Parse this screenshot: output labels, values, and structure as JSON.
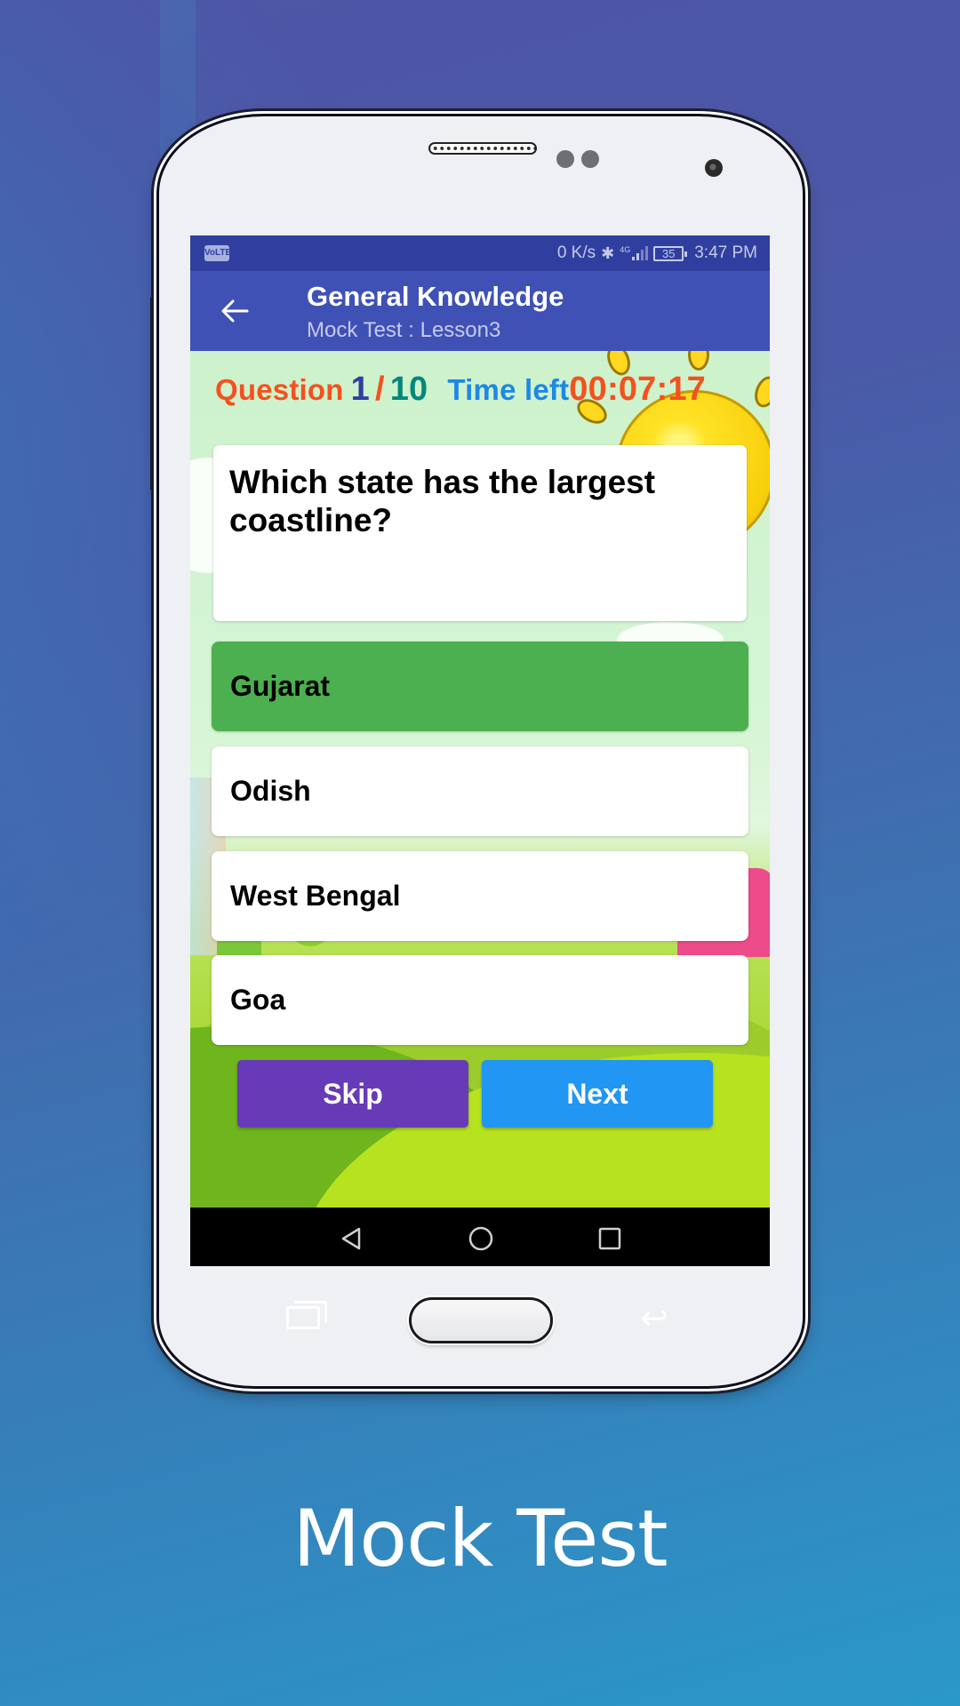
{
  "status_bar": {
    "volte_label": "VoLTE",
    "net_speed": "0 K/s",
    "bluetooth_icon": "bluetooth-icon",
    "network_type": "4G",
    "battery_level": "35",
    "time": "3:47 PM"
  },
  "app_bar": {
    "back_icon": "arrow-left-icon",
    "title": "General Knowledge",
    "subtitle": "Mock Test : Lesson3"
  },
  "quiz": {
    "question_label": "Question",
    "current_question": "1",
    "separator": "/",
    "total_questions": "10",
    "time_left_label": "Time left",
    "time_left_value": "00:07:17",
    "question_text": "Which state has the largest coastline?",
    "options": [
      {
        "label": "Gujarat",
        "selected": true
      },
      {
        "label": "Odish",
        "selected": false
      },
      {
        "label": "West Bengal",
        "selected": false
      },
      {
        "label": "Goa",
        "selected": false
      }
    ],
    "skip_label": "Skip",
    "next_label": "Next"
  },
  "nav_bar": {
    "back_icon": "nav-back-triangle-icon",
    "home_icon": "nav-home-circle-icon",
    "recents_icon": "nav-recents-square-icon"
  },
  "colors": {
    "status_bar": "#303f9f",
    "app_bar": "#3f51b5",
    "selected_option": "#4caf50",
    "skip_button": "#673ab7",
    "next_button": "#2196f3",
    "question_word": "#f4511e",
    "current_number": "#303f9f",
    "total_number": "#00897b",
    "time_label": "#1e88e5",
    "time_value": "#f4511e"
  },
  "caption": "Mock Test"
}
